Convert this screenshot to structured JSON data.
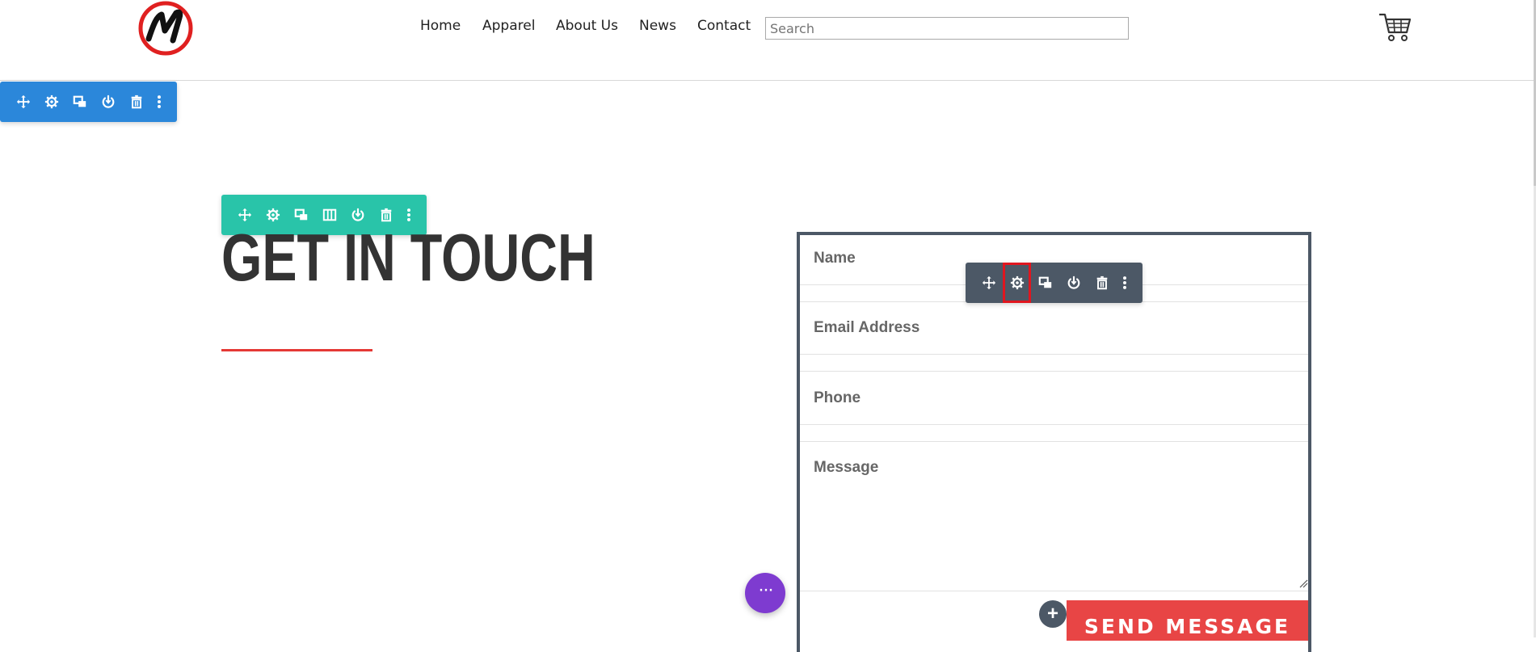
{
  "header": {
    "nav": [
      "Home",
      "Apparel",
      "About Us",
      "News",
      "Contact"
    ],
    "search_placeholder": "Search",
    "logo_icon": "m-circle-logo",
    "cart_icon": "shopping-cart-icon"
  },
  "section_toolbar": {
    "color": "#2b87da",
    "icons": [
      "move-icon",
      "gear-icon",
      "duplicate-icon",
      "save-to-library-icon",
      "trash-icon",
      "more-icon"
    ]
  },
  "row_toolbar": {
    "color": "#29c4a9",
    "icons": [
      "move-icon",
      "gear-icon",
      "duplicate-icon",
      "columns-icon",
      "save-to-library-icon",
      "trash-icon",
      "more-icon"
    ]
  },
  "module_toolbar": {
    "color": "#4c5866",
    "icons": [
      "move-icon",
      "gear-icon",
      "duplicate-icon",
      "save-to-library-icon",
      "trash-icon",
      "more-icon"
    ],
    "highlighted": "gear-icon",
    "highlight_color": "#e0161f"
  },
  "main": {
    "title": "GET IN TOUCH",
    "divider_color": "#e53935"
  },
  "form": {
    "fields": [
      "Name",
      "Email Address",
      "Phone",
      "Message"
    ],
    "submit_label": "SEND MESSAGE",
    "submit_color": "#e84545"
  },
  "builder": {
    "more_button_color": "#7e3bd0",
    "add_module_label": "+",
    "more_label": "···"
  }
}
